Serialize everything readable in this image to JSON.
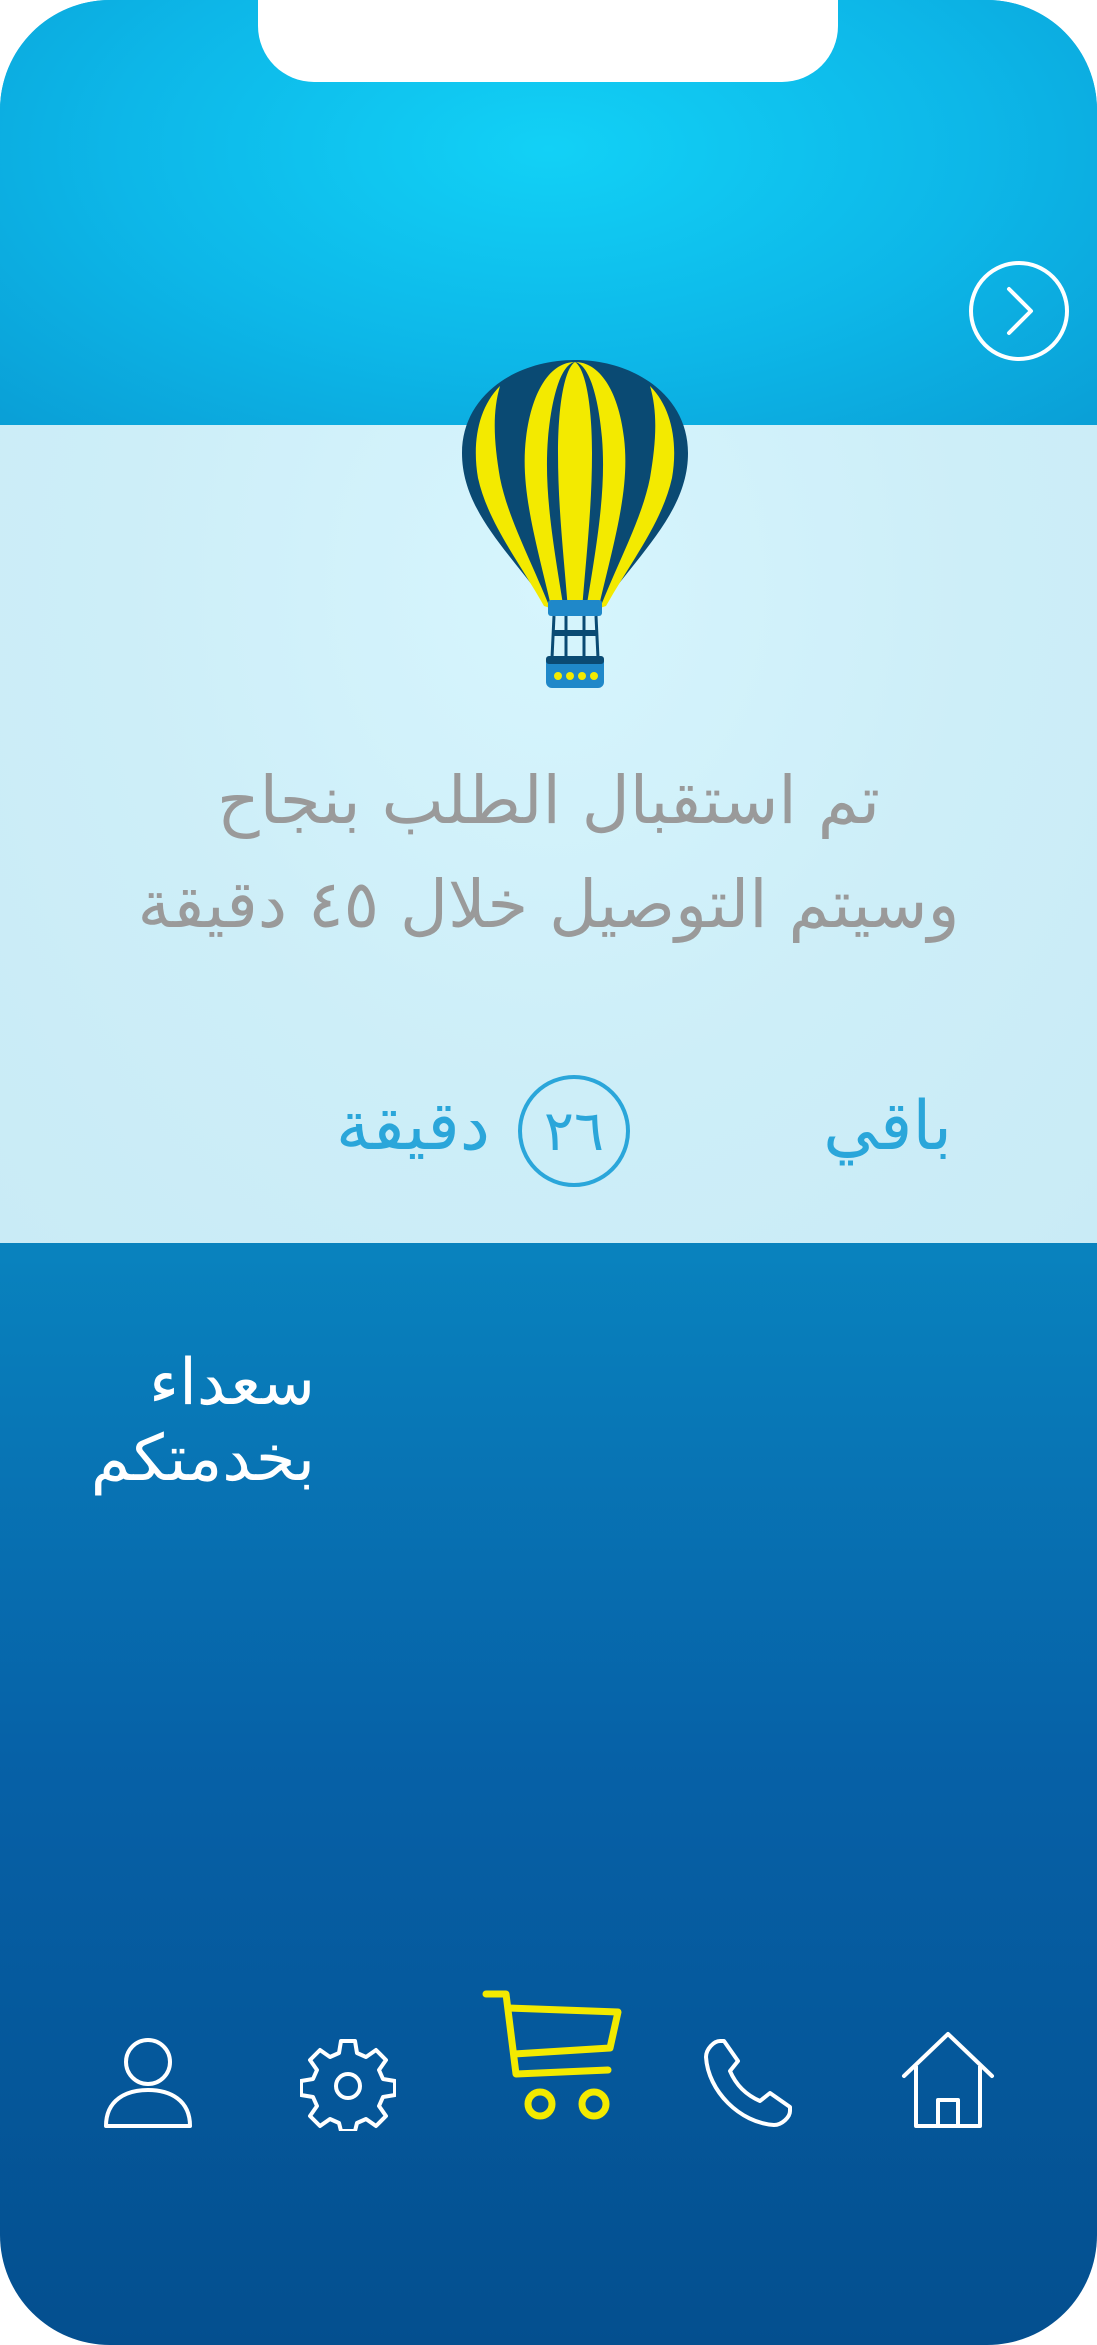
{
  "header": {
    "back_icon": "chevron-right-icon"
  },
  "illustration": {
    "icon": "hot-air-balloon-icon",
    "colors": {
      "stripe_yellow": "#f3ea00",
      "stripe_navy": "#0a4a73",
      "basket": "#1f88c9"
    }
  },
  "message": {
    "line1": "تم استقبال الطلب بنجاح",
    "line2": "وسيتم التوصيل خلال ٤٥ دقيقة"
  },
  "countdown": {
    "prefix": "باقي",
    "value": "٢٦",
    "unit": "دقيقة"
  },
  "slogan": {
    "line1": "سعداء",
    "line2": "بخدمتكم"
  },
  "bottom_nav": {
    "items": [
      {
        "name": "profile",
        "icon": "user-icon"
      },
      {
        "name": "settings",
        "icon": "gear-icon"
      },
      {
        "name": "cart",
        "icon": "cart-icon",
        "active": true
      },
      {
        "name": "call",
        "icon": "phone-icon"
      },
      {
        "name": "home",
        "icon": "home-icon"
      }
    ]
  },
  "colors": {
    "top_cyan": "#12d1f6",
    "panel_light": "#cdeef8",
    "accent_blue": "#2aa6da",
    "message_gray": "#9a9a9a",
    "active_yellow": "#f3ea00",
    "bottom_navy": "#044f8f"
  }
}
